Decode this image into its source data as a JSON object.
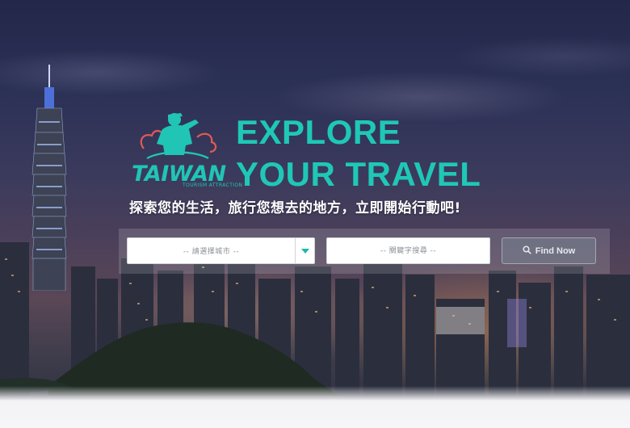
{
  "brand": {
    "logo_word": "TAIWAN",
    "logo_subtitle": "TOURISM ATTRACTION",
    "accent_color": "#1fc8b6"
  },
  "hero": {
    "headline_line1": "EXPLORE",
    "headline_line2": "YOUR TRAVEL",
    "tagline": "探索您的生活，旅行您想去的地方，立即開始行動吧!"
  },
  "search": {
    "city_select_label": "-- 請選擇城市 --",
    "keyword_placeholder": "-- 關鍵字搜尋 --",
    "find_button_label": "Find Now",
    "find_button_icon": "search-icon",
    "select_icon": "caret-down-icon"
  }
}
